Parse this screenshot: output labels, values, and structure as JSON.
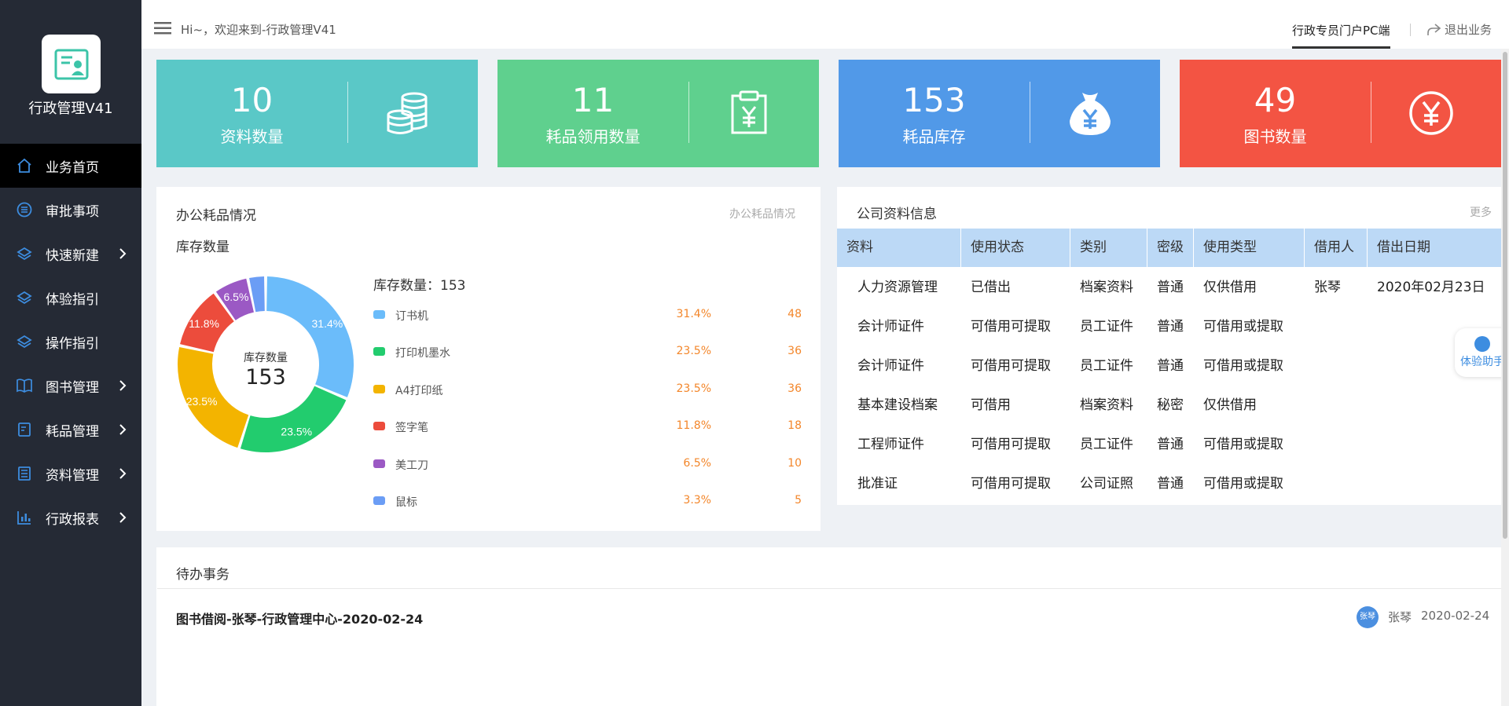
{
  "app": {
    "title": "行政管理V41"
  },
  "sidebar": {
    "items": [
      {
        "label": "业务首页",
        "icon": "home-icon",
        "active": true,
        "has_children": false
      },
      {
        "label": "审批事项",
        "icon": "list-circle-icon",
        "active": false,
        "has_children": false
      },
      {
        "label": "快速新建",
        "icon": "layers-icon",
        "active": false,
        "has_children": true
      },
      {
        "label": "体验指引",
        "icon": "layers-icon",
        "active": false,
        "has_children": false
      },
      {
        "label": "操作指引",
        "icon": "layers-icon",
        "active": false,
        "has_children": false
      },
      {
        "label": "图书管理",
        "icon": "book-icon",
        "active": false,
        "has_children": true
      },
      {
        "label": "耗品管理",
        "icon": "clipboard-icon",
        "active": false,
        "has_children": true
      },
      {
        "label": "资料管理",
        "icon": "document-icon",
        "active": false,
        "has_children": true
      },
      {
        "label": "行政报表",
        "icon": "bar-chart-icon",
        "active": false,
        "has_children": true
      }
    ]
  },
  "header": {
    "greeting": "Hi~，欢迎来到-行政管理V41",
    "portal_tab": "行政专员门户PC端",
    "logout": "退出业务"
  },
  "stats": [
    {
      "value": "10",
      "label": "资料数量",
      "color": "#5ac8c7",
      "icon": "coins-stack-icon"
    },
    {
      "value": "11",
      "label": "耗品领用数量",
      "color": "#5fd08e",
      "icon": "clipboard-yen-icon"
    },
    {
      "value": "153",
      "label": "耗品库存",
      "color": "#5199e8",
      "icon": "money-bag-icon"
    },
    {
      "value": "49",
      "label": "图书数量",
      "color": "#f35443",
      "icon": "yen-circle-icon"
    }
  ],
  "supplies_panel": {
    "title": "办公耗品情况",
    "more": "办公耗品情况",
    "subtitle": "库存数量",
    "center_label": "库存数量",
    "center_value": "153",
    "legend_total": "库存数量：153"
  },
  "chart_data": {
    "type": "pie",
    "series": [
      {
        "name": "订书机",
        "percent": "31.4%",
        "value": 48,
        "color": "#6bbcfa"
      },
      {
        "name": "打印机墨水",
        "percent": "23.5%",
        "value": 36,
        "color": "#22cc6e"
      },
      {
        "name": "A4打印纸",
        "percent": "23.5%",
        "value": 36,
        "color": "#f3b400"
      },
      {
        "name": "签字笔",
        "percent": "11.8%",
        "value": 18,
        "color": "#ec4c3c"
      },
      {
        "name": "美工刀",
        "percent": "6.5%",
        "value": 10,
        "color": "#9b59c4"
      },
      {
        "name": "鼠标",
        "percent": "3.3%",
        "value": 5,
        "color": "#6b9df5"
      }
    ]
  },
  "docs_panel": {
    "title": "公司资料信息",
    "more": "更多",
    "columns": [
      "资料",
      "使用状态",
      "类别",
      "密级",
      "使用类型",
      "借用人",
      "借出日期"
    ],
    "rows": [
      [
        "人力资源管理",
        "已借出",
        "档案资料",
        "普通",
        "仅供借用",
        "张琴",
        "2020年02月23日"
      ],
      [
        "会计师证件",
        "可借用可提取",
        "员工证件",
        "普通",
        "可借用或提取",
        "",
        ""
      ],
      [
        "会计师证件",
        "可借用可提取",
        "员工证件",
        "普通",
        "可借用或提取",
        "",
        ""
      ],
      [
        "基本建设档案",
        "可借用",
        "档案资料",
        "秘密",
        "仅供借用",
        "",
        ""
      ],
      [
        "工程师证件",
        "可借用可提取",
        "员工证件",
        "普通",
        "可借用或提取",
        "",
        ""
      ],
      [
        "批准证",
        "可借用可提取",
        "公司证照",
        "普通",
        "可借用或提取",
        "",
        ""
      ]
    ]
  },
  "helper": {
    "label": "体验助手"
  },
  "todo_panel": {
    "title": "待办事务",
    "items": [
      {
        "title": "图书借阅-张琴-行政管理中心-2020-02-24",
        "avatar": "张琴",
        "user": "张琴",
        "date": "2020-02-24"
      }
    ]
  }
}
